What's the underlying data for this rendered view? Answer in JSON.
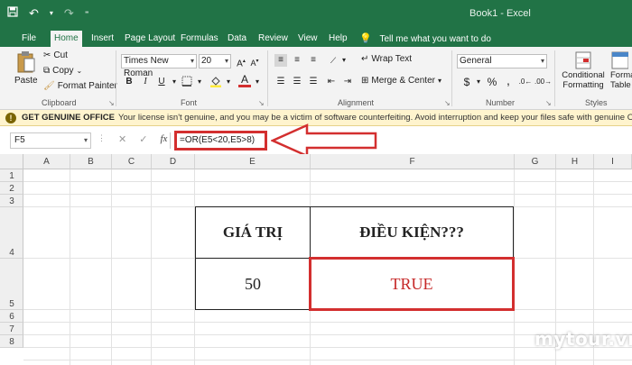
{
  "title_bar": {
    "document_title": "Book1  -  Excel",
    "qat_icons": [
      "save-icon",
      "undo-icon",
      "redo-icon",
      "customize-icon"
    ]
  },
  "tabs": [
    {
      "label": "File",
      "active": false
    },
    {
      "label": "Home",
      "active": true
    },
    {
      "label": "Insert",
      "active": false
    },
    {
      "label": "Page Layout",
      "active": false
    },
    {
      "label": "Formulas",
      "active": false
    },
    {
      "label": "Data",
      "active": false
    },
    {
      "label": "Review",
      "active": false
    },
    {
      "label": "View",
      "active": false
    },
    {
      "label": "Help",
      "active": false
    }
  ],
  "tell_me": "Tell me what you want to do",
  "ribbon": {
    "clipboard": {
      "label": "Clipboard",
      "paste": "Paste",
      "cut": "Cut",
      "copy": "Copy",
      "format_painter": "Format Painter"
    },
    "font": {
      "label": "Font",
      "font_name": "Times New Roman",
      "font_size": "20",
      "bold": "B",
      "italic": "I",
      "underline": "U",
      "font_color_glyph": "A"
    },
    "alignment": {
      "label": "Alignment",
      "wrap_text": "Wrap Text",
      "merge_center": "Merge & Center"
    },
    "number": {
      "label": "Number",
      "format": "General",
      "currency": "$",
      "percent": "%",
      "comma": ","
    },
    "styles": {
      "label": "Styles",
      "conditional_formatting_1": "Conditional",
      "conditional_formatting_2": "Formatting",
      "format_table_1": "Forma",
      "format_table_2": "Table"
    }
  },
  "message_bar": {
    "title": "GET GENUINE OFFICE",
    "text": "Your license isn't genuine, and you may be a victim of software counterfeiting. Avoid interruption and keep your files safe with genuine Office today."
  },
  "formula_bar": {
    "name_box": "F5",
    "fx": "fx",
    "formula": "=OR(E5<20,E5>8)"
  },
  "columns": [
    "A",
    "B",
    "C",
    "D",
    "E",
    "F",
    "G",
    "H",
    "I"
  ],
  "rows": [
    "1",
    "2",
    "3",
    "4",
    "5",
    "6",
    "7",
    "8"
  ],
  "table": {
    "header_value": "GIÁ TRỊ",
    "header_condition": "ĐIỀU KIỆN???",
    "value": "50",
    "result": "TRUE"
  },
  "colors": {
    "excel_green": "#217346",
    "highlight_red": "#d32f2f",
    "result_text": "#c62828"
  },
  "watermark": "mytour.vn"
}
